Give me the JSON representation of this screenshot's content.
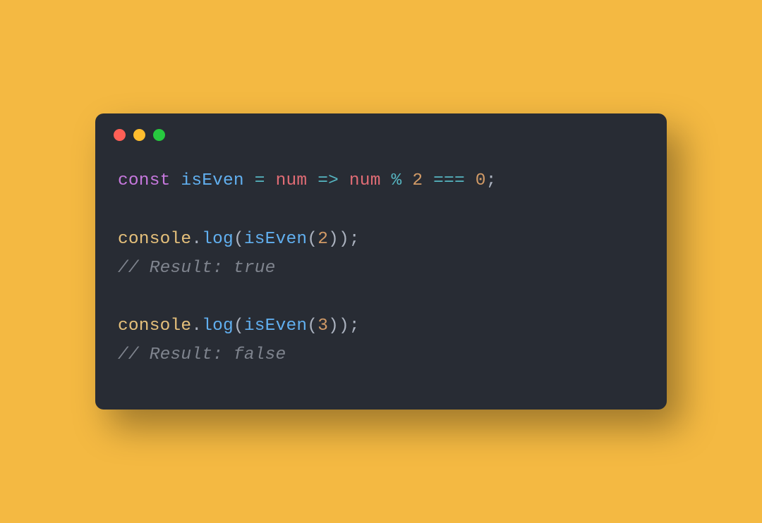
{
  "code": {
    "line1": {
      "const": "const",
      "sp1": " ",
      "isEven": "isEven",
      "sp2": " ",
      "eq": "=",
      "sp3": " ",
      "num1": "num",
      "sp4": " ",
      "arrow": "=>",
      "sp5": " ",
      "num2": "num",
      "sp6": " ",
      "mod": "%",
      "sp7": " ",
      "two": "2",
      "sp8": " ",
      "eqeqeq": "===",
      "sp9": " ",
      "zero": "0",
      "semi": ";"
    },
    "line3": {
      "console": "console",
      "dot": ".",
      "log": "log",
      "lp": "(",
      "isEven": "isEven",
      "lp2": "(",
      "two": "2",
      "rp2": ")",
      "rp": ")",
      "semi": ";"
    },
    "line4": {
      "comment": "// Result: true"
    },
    "line6": {
      "console": "console",
      "dot": ".",
      "log": "log",
      "lp": "(",
      "isEven": "isEven",
      "lp2": "(",
      "three": "3",
      "rp2": ")",
      "rp": ")",
      "semi": ";"
    },
    "line7": {
      "comment": "// Result: false"
    }
  }
}
